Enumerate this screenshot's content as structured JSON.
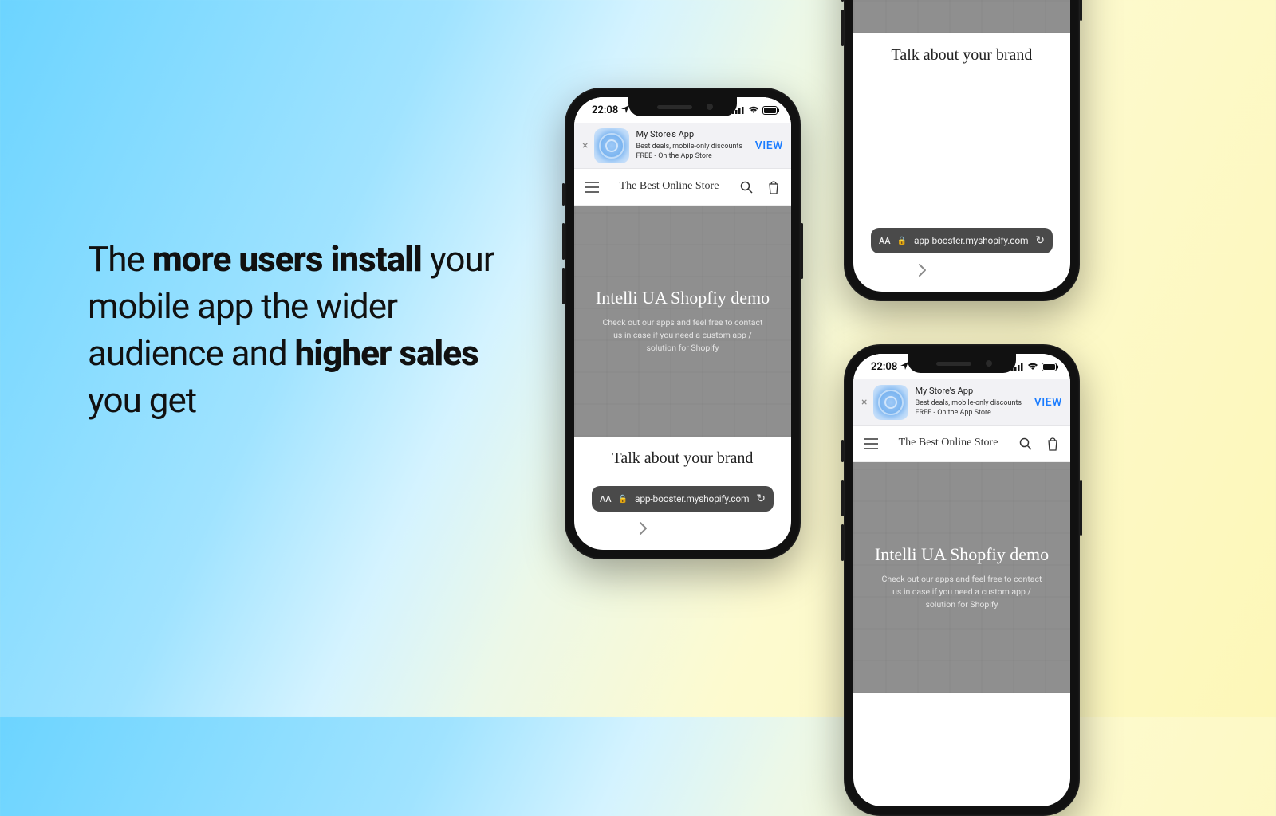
{
  "headline": {
    "part1": "The ",
    "bold1": "more users install",
    "part2": " your mobile app the wider audience and ",
    "bold2": "higher sales",
    "part3": " you get"
  },
  "status": {
    "time": "22:08"
  },
  "smart_banner": {
    "title": "My Store's App",
    "subtitle": "Best deals, mobile-only discounts",
    "price_line": "FREE - On the App Store",
    "view": "VIEW"
  },
  "store": {
    "title": "The Best Online Store"
  },
  "hero": {
    "title": "Intelli UA Shopfiy demo",
    "subtitle": "Check out our apps and feel free to contact us in case if you need a custom app / solution for Shopify"
  },
  "cta": "Talk about your brand",
  "url_bar": {
    "aa": "AA",
    "address": "app-booster.myshopify.com"
  }
}
